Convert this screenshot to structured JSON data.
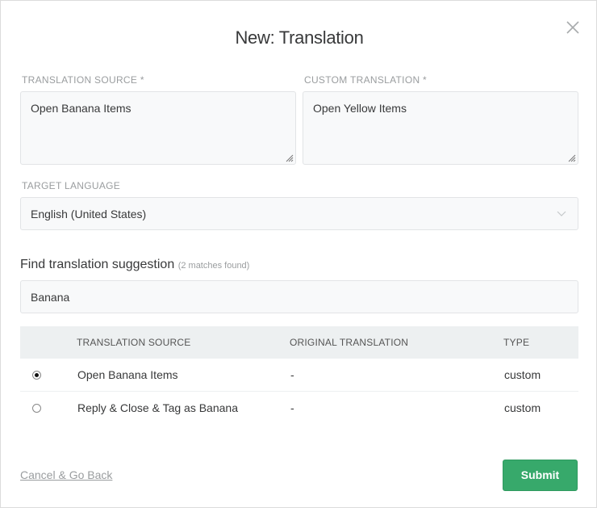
{
  "dialog": {
    "title": "New: Translation",
    "close_icon": "close-x-icon"
  },
  "form": {
    "source_label": "TRANSLATION SOURCE *",
    "source_value": "Open Banana Items",
    "custom_label": "CUSTOM TRANSLATION *",
    "custom_value": "Open Yellow Items",
    "language_label": "TARGET LANGUAGE",
    "language_value": "English (United States)"
  },
  "suggestion": {
    "heading": "Find translation suggestion",
    "matches": "(2 matches found)",
    "search_value": "Banana",
    "columns": [
      "TRANSLATION SOURCE",
      "ORIGINAL TRANSLATION",
      "TYPE"
    ],
    "rows": [
      {
        "selected": true,
        "source": "Open Banana Items",
        "original": "-",
        "type": "custom"
      },
      {
        "selected": false,
        "source": "Reply & Close & Tag as Banana",
        "original": "-",
        "type": "custom"
      }
    ]
  },
  "footer": {
    "cancel_label": "Cancel & Go Back",
    "submit_label": "Submit"
  },
  "colors": {
    "accent": "#37a96b",
    "field_bg": "#f8f9fa",
    "table_header_bg": "#edf0f1"
  }
}
